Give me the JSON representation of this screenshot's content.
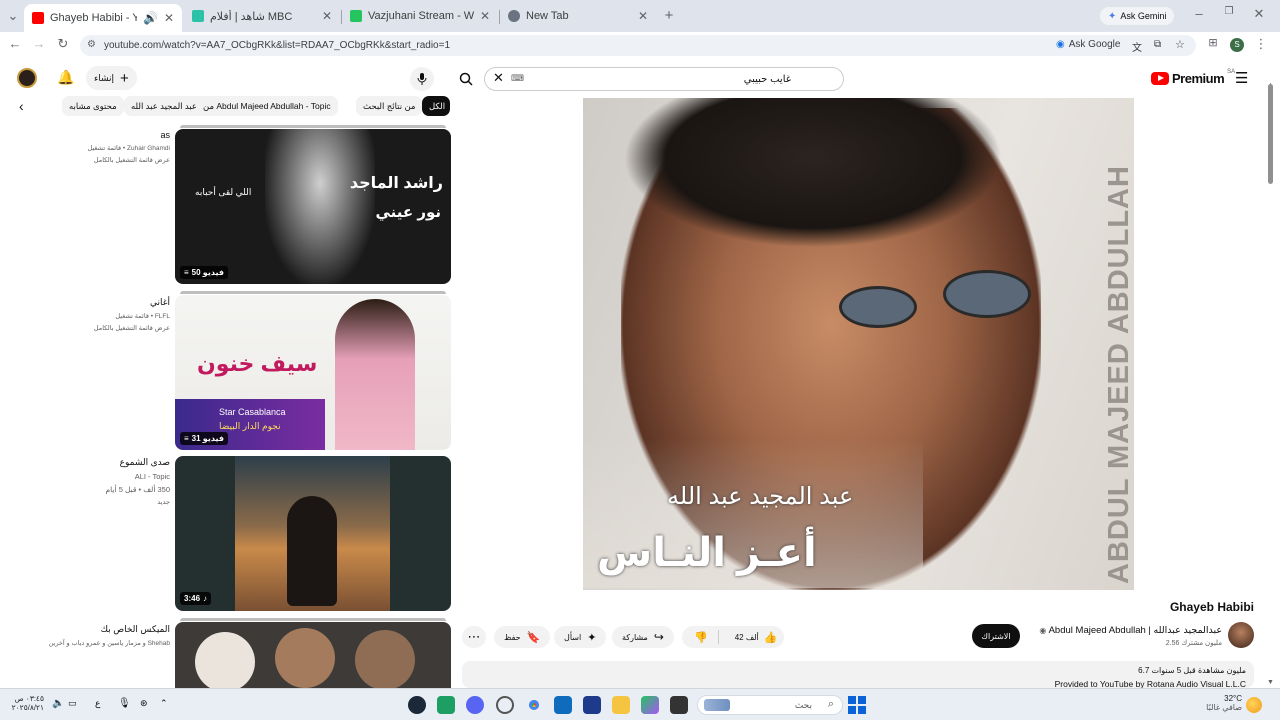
{
  "browser": {
    "tabs": [
      {
        "title": "Ghayeb Habibi - YouTube",
        "favicon_color": "#ff0000"
      },
      {
        "title": "شاهد | أفلام MBC",
        "favicon_color": "#2bc2a8"
      },
      {
        "title": "Vazjuhani Stream - Watch Live",
        "favicon_color": "#23c55e"
      },
      {
        "title": "New Tab",
        "favicon_color": "#6b7280"
      }
    ],
    "ask_gemini": "Ask Gemini",
    "url": "youtube.com/watch?v=AA7_OCbgRKk&list=RDAA7_OCbgRKk&start_radio=1",
    "ask_google": "Ask Google"
  },
  "header": {
    "logo_text": "Premium",
    "region": "SA",
    "search_value": "غايب حبيبي",
    "create_label": "إنشاء"
  },
  "chips": [
    "الكل",
    "من نتائج البحث",
    "من Abdul Majeed Abdullah - Topic",
    "عبد المجيد عبد الله",
    "محتوى مشابه"
  ],
  "playlists": [
    {
      "title": "as",
      "subtitle": "Zuhair Ghamdi • قائمة تشغيل",
      "sub2": "عرض قائمة التشغيل بالكامل",
      "badge": "50 فيديو",
      "thumb_text1": "راشد الماجد",
      "thumb_text2": "نور عيني",
      "thumb_text3": "اللي لقى أحبابه"
    },
    {
      "title": "أغاني",
      "subtitle": "FLFL • قائمة تشغيل",
      "sub2": "عرض قائمة التشغيل بالكامل",
      "badge": "31 فيديو",
      "thumb_text1": "سيف خنون",
      "thumb_text2": "Star Casablanca",
      "thumb_text3": "نجوم الدار البيضا"
    },
    {
      "title": "صدى الشموع",
      "subtitle": "ALI - Topic",
      "sub2": "350 ألف • قبل 5 أيام",
      "sub3": "جديد",
      "badge": "3:46"
    },
    {
      "title": "الميكس الخاص بك",
      "subtitle": "Shehab و مزمار ياسين و عمرو دياب و آخرين",
      "sub2": ""
    }
  ],
  "video": {
    "overlay_name": "عبد المجيد عبد الله",
    "overlay_title": "أعـز النـاس",
    "side_text": "ABDUL MAJEED ABDULLAH",
    "title": "Ghayeb Habibi",
    "channel": "Abdul Majeed Abdullah | عبدالمجيد عبدالله",
    "subscribers": "2.56 مليون مشترك",
    "subscribe_label": "الاشتراك",
    "likes": "42 ألف",
    "share_label": "مشاركة",
    "ask_label": "اسأل",
    "save_label": "حفظ",
    "views": "6.7 مليون مشاهدة قبل 5 سنوات",
    "provided": "Provided to YouTube by Rotana Audio Visual L.L.C"
  },
  "taskbar": {
    "search_placeholder": "بحث",
    "time": "٠٣:٤٥ ص",
    "date": "٢٠٢٥/٨/٢١",
    "weather_temp": "32°C",
    "weather_desc": "صافي غالبًا"
  }
}
